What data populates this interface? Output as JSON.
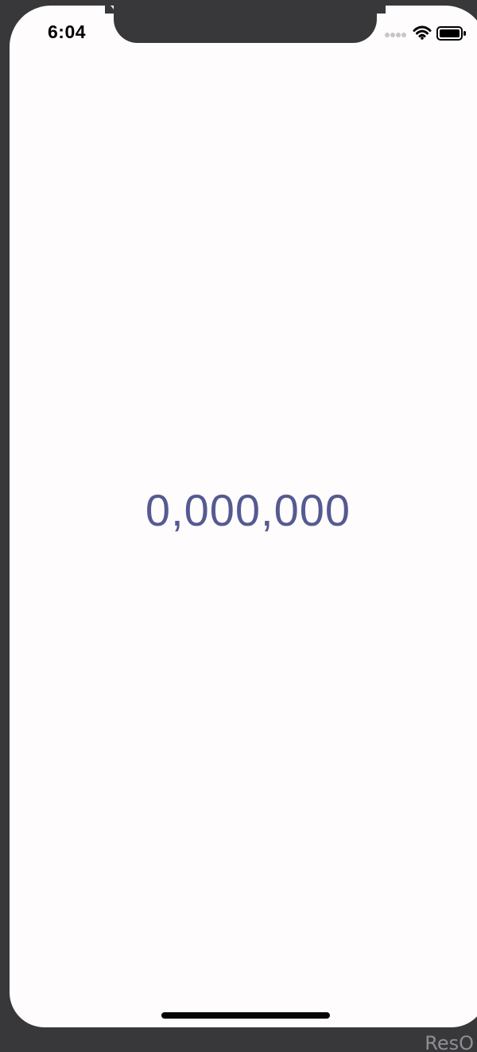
{
  "status_bar": {
    "time": "6:04",
    "signal_icon": "cellular-signal-icon",
    "wifi_icon": "wifi-icon",
    "battery_icon": "battery-icon"
  },
  "main": {
    "counter_value": "0,000,000",
    "counter_color": "#555a91"
  },
  "background": {
    "partial_text": "ResO"
  },
  "colors": {
    "screen": "#fefcfd",
    "device": "#38383b",
    "home_indicator": "#050505"
  }
}
